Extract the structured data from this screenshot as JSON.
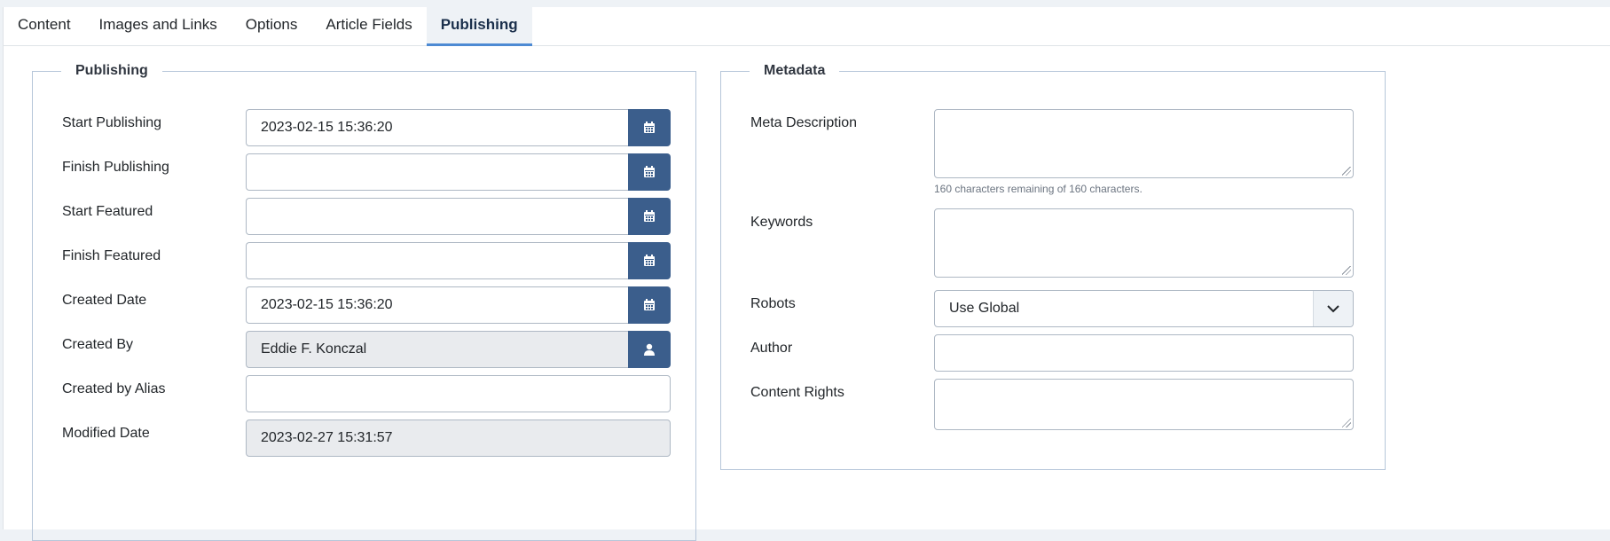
{
  "tabs": [
    {
      "label": "Content"
    },
    {
      "label": "Images and Links"
    },
    {
      "label": "Options"
    },
    {
      "label": "Article Fields"
    },
    {
      "label": "Publishing",
      "active": true
    }
  ],
  "publishing": {
    "legend": "Publishing",
    "fields": [
      {
        "label": "Start Publishing",
        "value": "2023-02-15 15:36:20",
        "button_icon": "calendar-icon"
      },
      {
        "label": "Finish Publishing",
        "value": "",
        "button_icon": "calendar-icon"
      },
      {
        "label": "Start Featured",
        "value": "",
        "button_icon": "calendar-icon"
      },
      {
        "label": "Finish Featured",
        "value": "",
        "button_icon": "calendar-icon"
      },
      {
        "label": "Created Date",
        "value": "2023-02-15 15:36:20",
        "button_icon": "calendar-icon"
      },
      {
        "label": "Created By",
        "value": "Eddie F. Konczal",
        "button_icon": "user-icon"
      },
      {
        "label": "Created by Alias",
        "value": ""
      },
      {
        "label": "Modified Date",
        "value": "2023-02-27 15:31:57"
      }
    ]
  },
  "metadata": {
    "legend": "Metadata",
    "meta_description": {
      "label": "Meta Description",
      "value": "",
      "hint": "160 characters remaining of 160 characters."
    },
    "keywords": {
      "label": "Keywords",
      "value": ""
    },
    "robots": {
      "label": "Robots",
      "selected": "Use Global"
    },
    "author": {
      "label": "Author",
      "value": ""
    },
    "content_rights": {
      "label": "Content Rights",
      "value": ""
    }
  },
  "colors": {
    "accent_button": "#3b5e8c",
    "tab_active_border": "#4d8ad3",
    "fieldset_border": "#b6c6d9"
  }
}
